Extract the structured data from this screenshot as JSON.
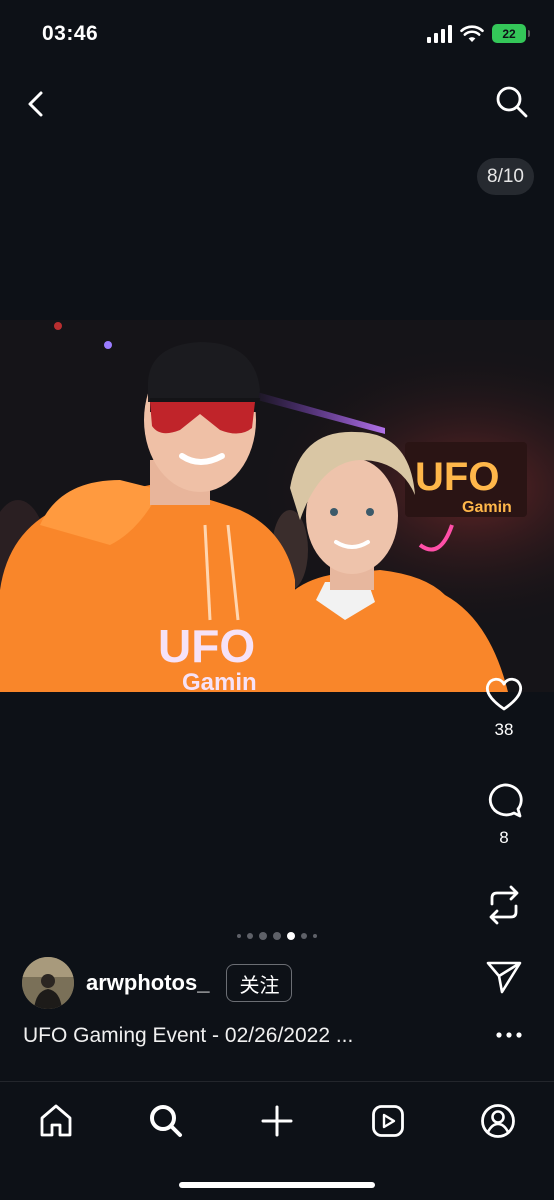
{
  "status_bar": {
    "time": "03:46",
    "battery": "22"
  },
  "nav": {
    "back_icon": "chevron-left-icon",
    "search_icon": "search-icon"
  },
  "photo": {
    "counter": "8/10",
    "alt_brand_text": "UFO Gaming"
  },
  "actions": {
    "likes": "38",
    "comments": "8"
  },
  "carousel": {
    "dots_count": 6,
    "active_index": 4
  },
  "author": {
    "username": "arwphotos_",
    "follow_label": "关注"
  },
  "caption": "UFO Gaming Event - 02/26/2022 ...",
  "tab_bar": {
    "tabs": [
      "home",
      "search",
      "create",
      "reels",
      "profile"
    ]
  },
  "colors": {
    "background": "#0d1117",
    "hoodie_orange": "#f9862a",
    "battery_green": "#34c759"
  }
}
